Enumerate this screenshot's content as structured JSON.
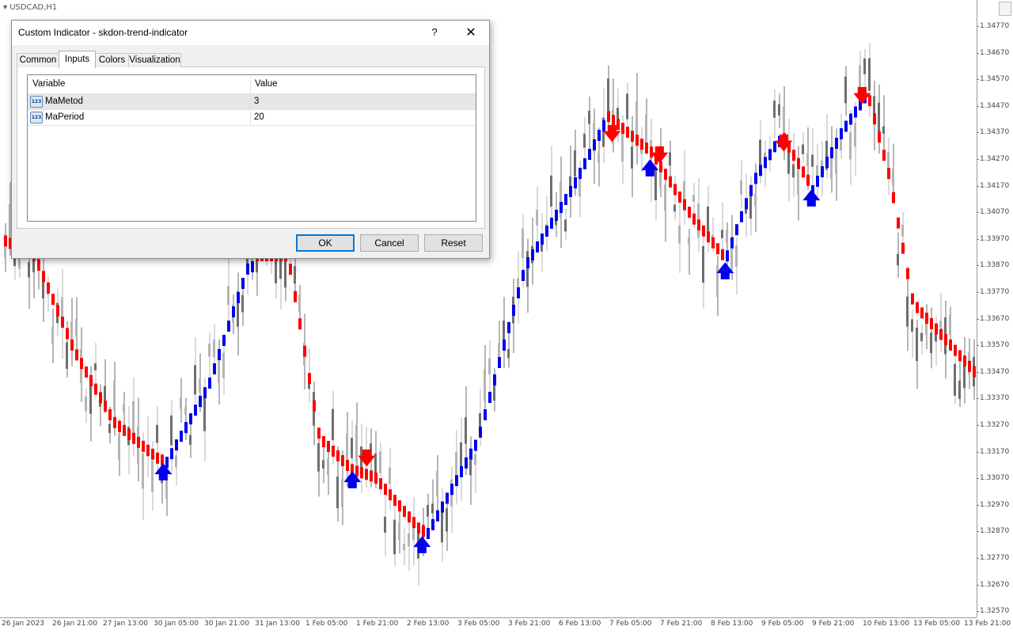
{
  "chart": {
    "symbol": "USDCAD,H1",
    "price_ticks": [
      "1.34770",
      "1.34670",
      "1.34570",
      "1.34470",
      "1.34370",
      "1.34270",
      "1.34170",
      "1.34070",
      "1.33970",
      "1.33870",
      "1.33770",
      "1.33670",
      "1.33570",
      "1.33470",
      "1.33370",
      "1.33270",
      "1.33170",
      "1.33070",
      "1.32970",
      "1.32870",
      "1.32770",
      "1.32670",
      "1.32570"
    ],
    "time_ticks": [
      "26 Jan 2023",
      "26 Jan 21:00",
      "27 Jan 13:00",
      "30 Jan 05:00",
      "30 Jan 21:00",
      "31 Jan 13:00",
      "1 Feb 05:00",
      "1 Feb 21:00",
      "2 Feb 13:00",
      "3 Feb 05:00",
      "3 Feb 21:00",
      "6 Feb 13:00",
      "7 Feb 05:00",
      "7 Feb 21:00",
      "8 Feb 13:00",
      "9 Feb 05:00",
      "9 Feb 21:00",
      "10 Feb 13:00",
      "13 Feb 05:00",
      "13 Feb 21:00"
    ],
    "colors": {
      "bull_trend": "#0000ee",
      "bear_trend": "#ff0000",
      "candle_light": "#b4b4b4",
      "candle_dark": "#6e6e6e"
    }
  },
  "dialog": {
    "title": "Custom Indicator - skdon-trend-indicator",
    "help_label": "?",
    "close_label": "✕",
    "tabs": [
      {
        "label": "Common"
      },
      {
        "label": "Inputs"
      },
      {
        "label": "Colors"
      },
      {
        "label": "Visualization"
      }
    ],
    "active_tab": "Inputs",
    "grid": {
      "headers": {
        "variable": "Variable",
        "value": "Value"
      },
      "rows": [
        {
          "icon": "123",
          "name": "MaMetod",
          "value": "3"
        },
        {
          "icon": "123",
          "name": "MaPeriod",
          "value": "20"
        }
      ]
    },
    "buttons": {
      "ok": "OK",
      "cancel": "Cancel",
      "reset": "Reset"
    }
  }
}
